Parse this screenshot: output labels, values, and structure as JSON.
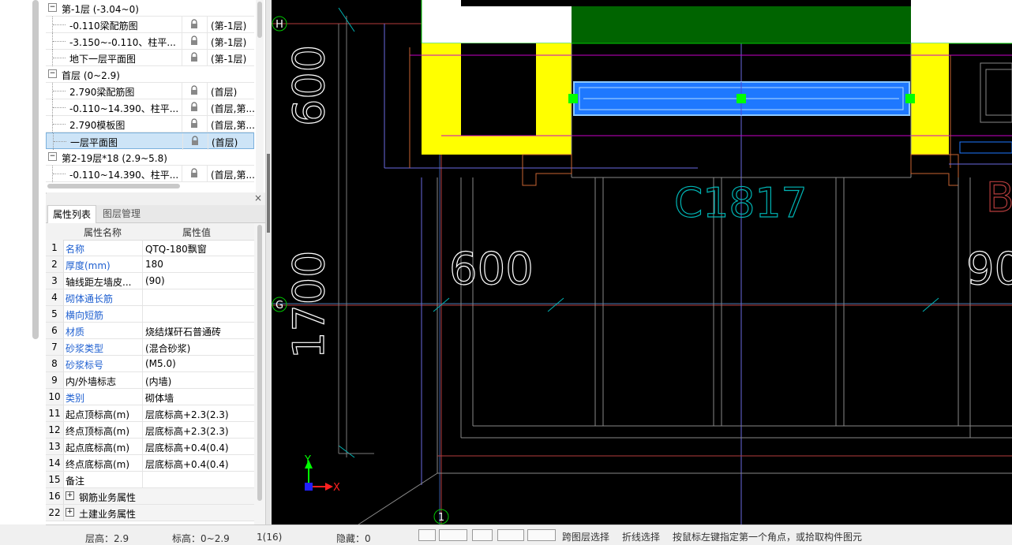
{
  "tree": {
    "rows": [
      {
        "type": "group",
        "label": "第-1层 (-3.04~0)",
        "expander": "−"
      },
      {
        "type": "child",
        "label": "-0.110梁配筋图",
        "floor": "(第-1层)"
      },
      {
        "type": "child",
        "label": "-3.150~-0.110、柱平...",
        "floor": "(第-1层)"
      },
      {
        "type": "child",
        "label": "地下一层平面图",
        "floor": "(第-1层)"
      },
      {
        "type": "group",
        "label": "首层 (0~2.9)",
        "expander": "−"
      },
      {
        "type": "child",
        "label": "2.790梁配筋图",
        "floor": "(首层)"
      },
      {
        "type": "child",
        "label": "-0.110~14.390、柱平...",
        "floor": "(首层,第..."
      },
      {
        "type": "child",
        "label": "2.790模板图",
        "floor": "(首层,第..."
      },
      {
        "type": "child",
        "label": "一层平面图",
        "floor": "(首层)",
        "selected": true
      },
      {
        "type": "group",
        "label": "第2-19层*18 (2.9~5.8)",
        "expander": "−"
      },
      {
        "type": "child",
        "label": "-0.110~14.390、柱平...",
        "floor": "(首层,第..."
      }
    ]
  },
  "panel": {
    "close": "×",
    "tabs": [
      "属性列表",
      "图层管理"
    ],
    "header": {
      "name": "属性名称",
      "value": "属性值"
    },
    "rows": [
      {
        "num": "1",
        "name": "名称",
        "value": "QTQ-180飘窗",
        "blue": true
      },
      {
        "num": "2",
        "name": "厚度(mm)",
        "value": "180",
        "blue": true
      },
      {
        "num": "3",
        "name": "轴线距左墙皮...",
        "value": "(90)",
        "blue": false
      },
      {
        "num": "4",
        "name": "砌体通长筋",
        "value": "",
        "blue": true
      },
      {
        "num": "5",
        "name": "横向短筋",
        "value": "",
        "blue": true
      },
      {
        "num": "6",
        "name": "材质",
        "value": "烧结煤矸石普通砖",
        "blue": true
      },
      {
        "num": "7",
        "name": "砂浆类型",
        "value": "(混合砂浆)",
        "blue": true
      },
      {
        "num": "8",
        "name": "砂浆标号",
        "value": "(M5.0)",
        "blue": true
      },
      {
        "num": "9",
        "name": "内/外墙标志",
        "value": "(内墙)",
        "blue": false
      },
      {
        "num": "10",
        "name": "类别",
        "value": "砌体墙",
        "blue": true
      },
      {
        "num": "11",
        "name": "起点顶标高(m)",
        "value": "层底标高+2.3(2.3)",
        "blue": false
      },
      {
        "num": "12",
        "name": "终点顶标高(m)",
        "value": "层底标高+2.3(2.3)",
        "blue": false
      },
      {
        "num": "13",
        "name": "起点底标高(m)",
        "value": "层底标高+0.4(0.4)",
        "blue": false
      },
      {
        "num": "14",
        "name": "终点底标高(m)",
        "value": "层底标高+0.4(0.4)",
        "blue": false
      },
      {
        "num": "15",
        "name": "备注",
        "value": "",
        "blue": false
      },
      {
        "num": "16",
        "name": "钢筋业务属性",
        "value": "",
        "group": true,
        "expander": "+"
      },
      {
        "num": "22",
        "name": "土建业务属性",
        "value": "",
        "group": true,
        "expander": "+"
      }
    ]
  },
  "canvas": {
    "axis_h": "H",
    "axis_g": "G",
    "axis_1": "1",
    "dim_600_vert": "600",
    "dim_1700_vert": "1700",
    "dim_600": "600",
    "dim_900": "90",
    "window_label": "C1817",
    "side_label": "B",
    "ucs_y": "Y",
    "ucs_x": "X",
    "colors": {
      "yellow": "#ffff00",
      "green": "#006400",
      "blue": "#1e78ff",
      "cyan": "#00b4b4",
      "grip": "#00ff00"
    }
  },
  "statusbar": {
    "floor_height": "层高：2.9",
    "elevation": "标高：0~2.9",
    "page": "1(16)",
    "hidden": "隐藏：0",
    "btn_cross_layer": "跨图层选择",
    "btn_polyline": "折线选择",
    "hint": "按鼠标左键指定第一个角点，或拾取构件图元"
  }
}
